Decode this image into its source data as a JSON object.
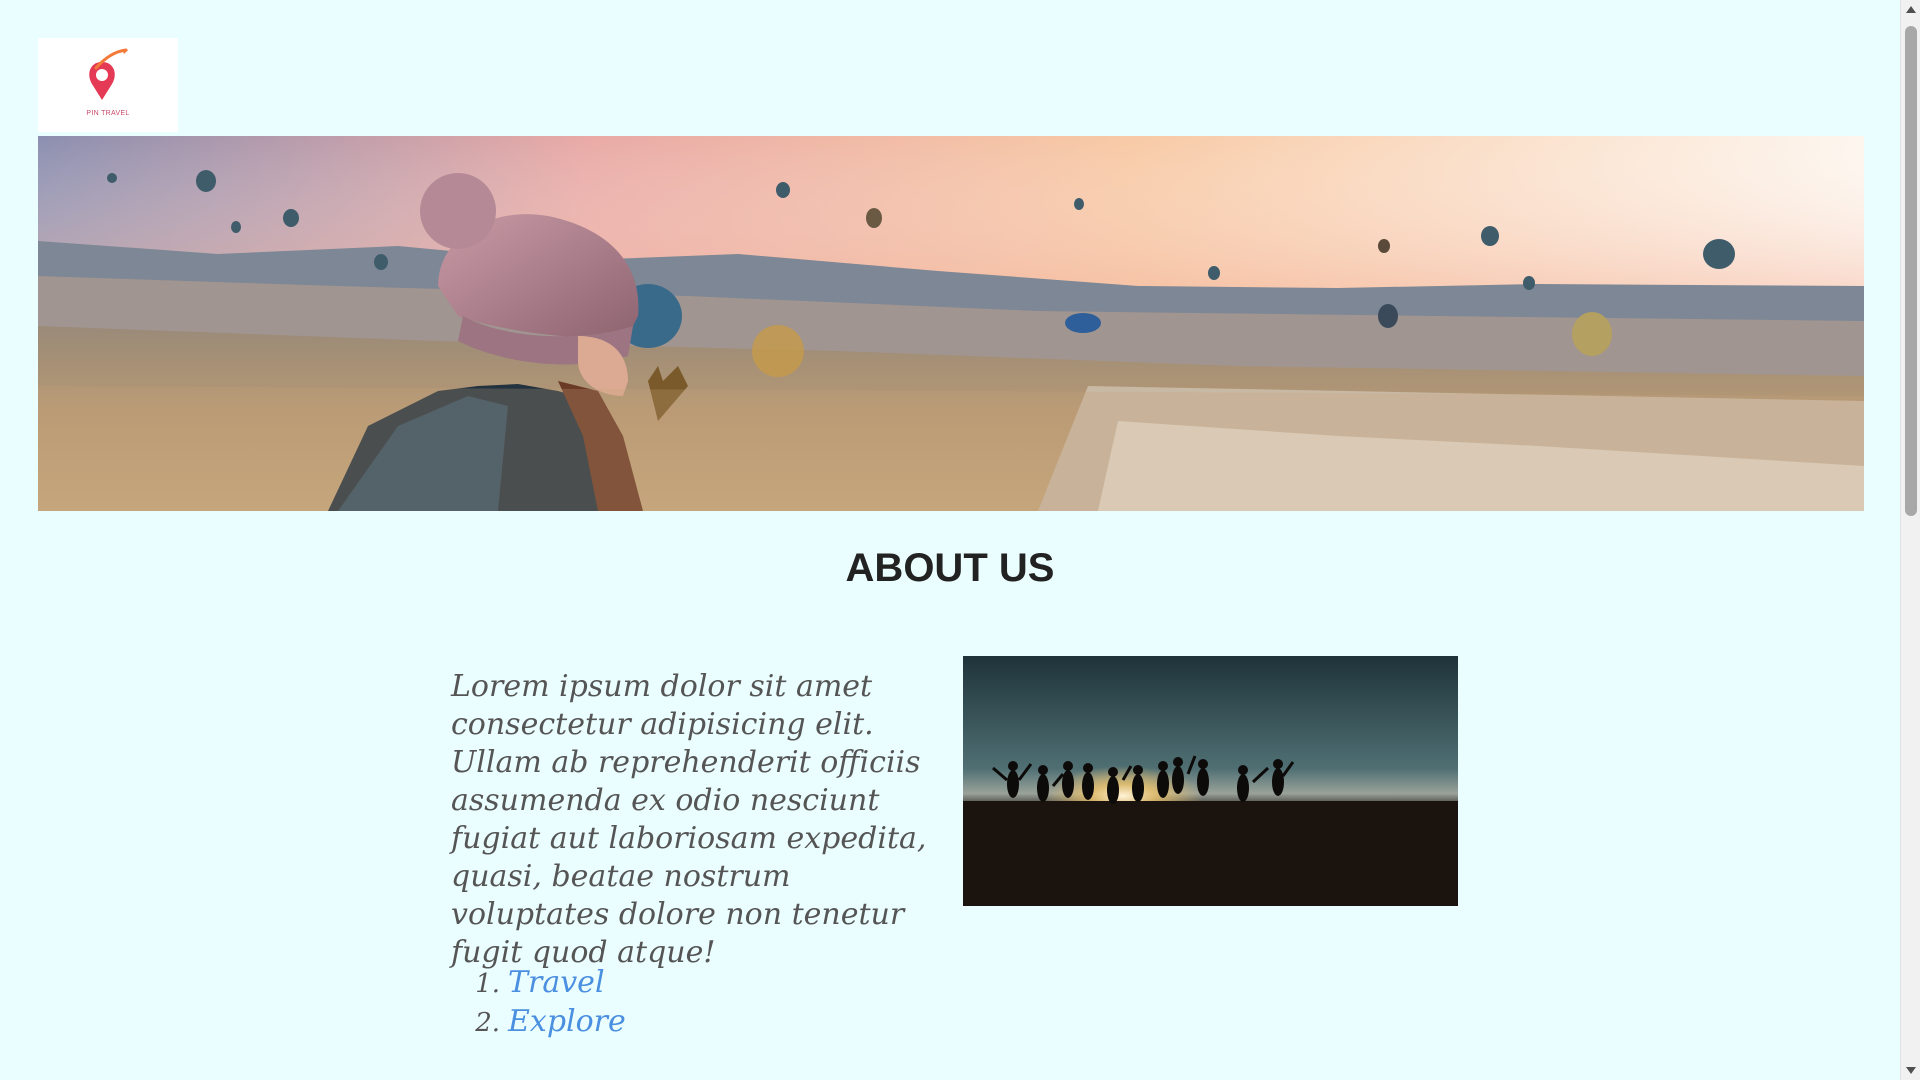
{
  "logo": {
    "icon": "pin-travel-logo-icon",
    "text": "PIN TRAVEL"
  },
  "hero": {
    "image": "hot-air-balloons-traveler-photo"
  },
  "about": {
    "title": "ABOUT US",
    "paragraph": "Lorem ipsum dolor sit amet consectetur adipisicing elit. Ullam ab reprehenderit officiis assumenda ex odio nesciunt fugiat aut laboriosam expedita, quasi, beatae nostrum voluptates dolore non tenetur fugit quod atque!",
    "image": "group-jumping-sunset-photo",
    "list": [
      {
        "number": "1.",
        "label": "Travel"
      },
      {
        "number": "2.",
        "label": "Explore"
      }
    ]
  },
  "colors": {
    "background": "#ebfeff",
    "link": "#4a8fe0",
    "heading": "#222222",
    "body_text": "#555555"
  }
}
